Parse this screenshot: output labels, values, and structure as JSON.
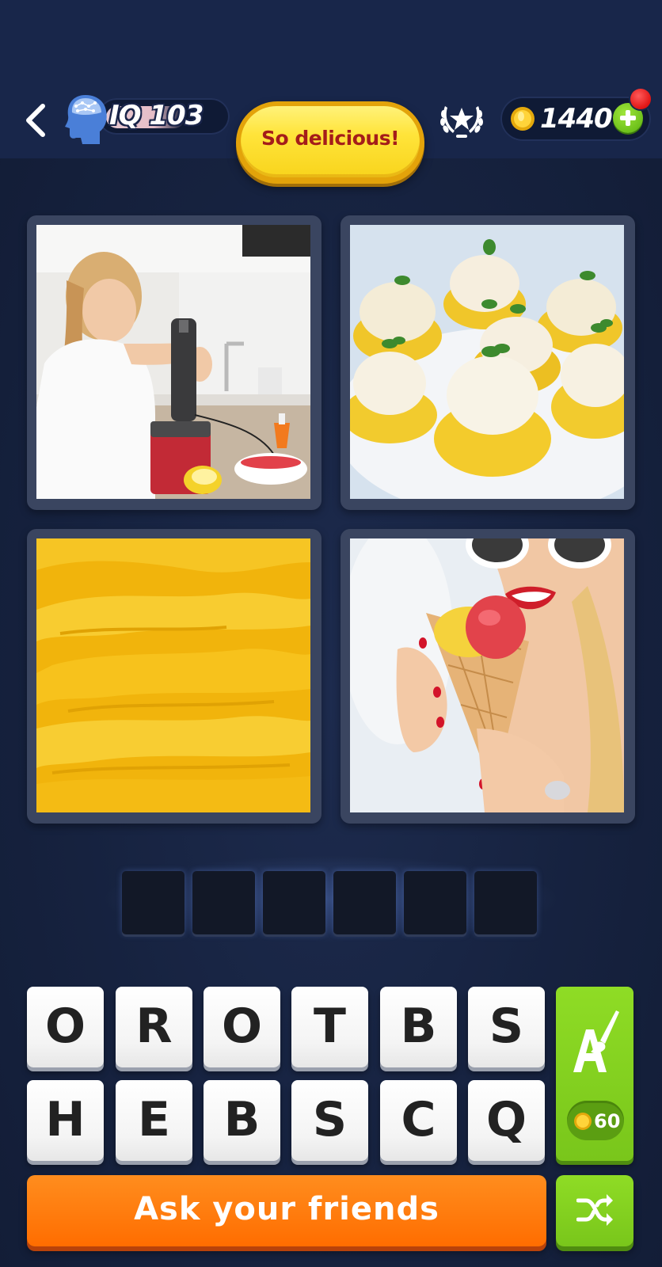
{
  "header": {
    "back_icon": "chevron-left-icon",
    "iq_label": "IQ 103",
    "title": "So delicious!",
    "rank_icon": "laurel-star-icon",
    "coins": "1440",
    "add_coins_icon": "plus-icon"
  },
  "pictures": [
    {
      "subject": "girl using hand blender"
    },
    {
      "subject": "sorbet in lemon halves"
    },
    {
      "subject": "yellow sorbet texture"
    },
    {
      "subject": "woman eating ice cream cone"
    }
  ],
  "answer": {
    "slot_count": 6,
    "slots": [
      "",
      "",
      "",
      "",
      "",
      ""
    ]
  },
  "keyboard": {
    "row1": [
      "O",
      "R",
      "O",
      "T",
      "B",
      "S"
    ],
    "row2": [
      "H",
      "E",
      "B",
      "S",
      "C",
      "Q"
    ]
  },
  "hint": {
    "icon": "letter-paintbrush-icon",
    "cost": "60"
  },
  "actions": {
    "ask_label": "Ask your friends",
    "shuffle_icon": "shuffle-icon"
  },
  "colors": {
    "background": "#16223f",
    "accent_orange": "#ff7a0f",
    "accent_green": "#82cf1f",
    "title_yellow": "#ffe43a",
    "title_text": "#a41d1a"
  }
}
